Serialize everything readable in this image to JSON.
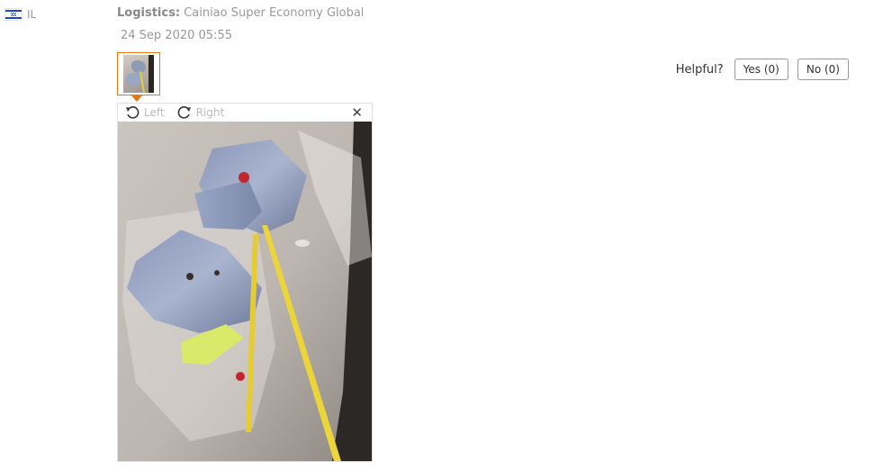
{
  "review": {
    "country_code": "IL",
    "logistics_label": "Logistics:",
    "logistics_value": "Cainiao Super Economy Global",
    "date": "24 Sep 2020 05:55"
  },
  "helpful": {
    "question": "Helpful?",
    "yes_label": "Yes (0)",
    "no_label": "No (0)"
  },
  "viewer": {
    "rotate_left_label": "Left",
    "rotate_right_label": "Right",
    "close_glyph": "✕"
  },
  "colors": {
    "accent": "#e47911",
    "muted_text": "#999999",
    "flag_blue": "#1d49b8"
  }
}
